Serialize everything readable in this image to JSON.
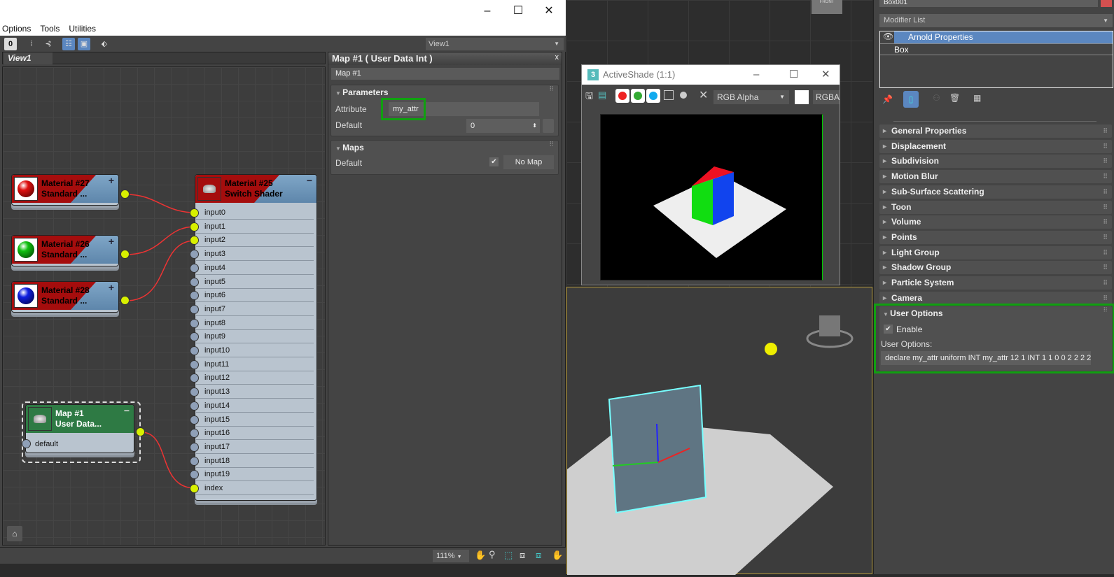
{
  "sme": {
    "menu": [
      "Options",
      "Tools",
      "Utilities"
    ],
    "window_buttons": [
      "–",
      "☐",
      "✕"
    ],
    "view_dropdown": "View1",
    "view_tab": "View1",
    "nodes": {
      "m27": {
        "name": "Material #27",
        "type": "Standard ...",
        "color": "#e01010"
      },
      "m26": {
        "name": "Material #26",
        "type": "Standard ...",
        "color": "#10c010"
      },
      "m28": {
        "name": "Material #28",
        "type": "Standard ...",
        "color": "#1020e0"
      },
      "m25": {
        "name": "Material #25",
        "type": "Switch Shader"
      },
      "map1": {
        "name": "Map #1",
        "type": "User Data...",
        "input": "default"
      }
    },
    "switch_inputs": [
      "input0",
      "input1",
      "input2",
      "input3",
      "input4",
      "input5",
      "input6",
      "input7",
      "input8",
      "input9",
      "input10",
      "input11",
      "input12",
      "input13",
      "input14",
      "input15",
      "input16",
      "input17",
      "input18",
      "input19",
      "index"
    ],
    "connected_inputs": [
      0,
      1,
      2,
      20
    ],
    "zoom": "111%"
  },
  "map_panel": {
    "title": "Map #1  ( User Data Int )",
    "name": "Map #1",
    "parameters_label": "Parameters",
    "attribute_label": "Attribute",
    "attribute_value": "my_attr",
    "default_label": "Default",
    "default_value": "0",
    "maps_label": "Maps",
    "maps_default_label": "Default",
    "no_map": "No Map"
  },
  "activeshade": {
    "title": "ActiveShade (1:1)",
    "channel": "RGB Alpha",
    "rgba": "RGBA"
  },
  "command_panel": {
    "object_name": "Box001",
    "modifier_list": "Modifier List",
    "stack": [
      "Arnold Properties",
      "Box"
    ],
    "rollouts": [
      "General Properties",
      "Displacement",
      "Subdivision",
      "Motion Blur",
      "Sub-Surface Scattering",
      "Toon",
      "Volume",
      "Points",
      "Light Group",
      "Shadow Group",
      "Particle System",
      "Camera"
    ],
    "user_options": {
      "title": "User Options",
      "enable": "Enable",
      "label": "User Options:",
      "value": "declare my_attr uniform INT my_attr  12 1 INT 1 1 0 0 2 2 2 2"
    }
  },
  "viewcube_label": "FRONT",
  "highlight_color": "#10a010"
}
